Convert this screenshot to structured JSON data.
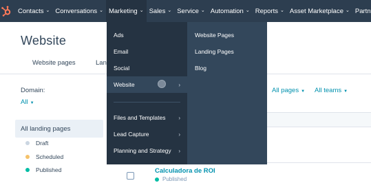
{
  "topnav": {
    "logo_icon": "hubspot-sprocket-icon",
    "items": [
      {
        "label": "Contacts"
      },
      {
        "label": "Conversations"
      },
      {
        "label": "Marketing"
      },
      {
        "label": "Sales"
      },
      {
        "label": "Service"
      },
      {
        "label": "Automation"
      },
      {
        "label": "Reports"
      },
      {
        "label": "Asset Marketplace"
      },
      {
        "label": "Partner"
      }
    ],
    "chevron": "⌄"
  },
  "page": {
    "title": "Website",
    "tabs": [
      {
        "label": "Website pages"
      },
      {
        "label": "Lan"
      }
    ]
  },
  "filters": {
    "domain_label": "Domain:",
    "domain_value": "All",
    "all_pages": "All pages",
    "all_teams": "All teams",
    "caret": "▼"
  },
  "sidebar": {
    "all_label": "All landing pages",
    "statuses": [
      {
        "label": "Draft",
        "color": "#cbd6e2"
      },
      {
        "label": "Scheduled",
        "color": "#f5c26b"
      },
      {
        "label": "Published",
        "color": "#00bda5"
      }
    ]
  },
  "table": {
    "row": {
      "title": "Calculadora de ROI",
      "status": "Published",
      "status_color": "#00bda5"
    }
  },
  "marketing_menu": {
    "left": [
      {
        "label": "Ads",
        "has_submenu": false
      },
      {
        "label": "Email",
        "has_submenu": false
      },
      {
        "label": "Social",
        "has_submenu": false
      },
      {
        "label": "Website",
        "has_submenu": true,
        "selected": true
      },
      {
        "label": "Files and Templates",
        "has_submenu": true
      },
      {
        "label": "Lead Capture",
        "has_submenu": true
      },
      {
        "label": "Planning and Strategy",
        "has_submenu": true
      }
    ],
    "right": [
      {
        "label": "Website Pages"
      },
      {
        "label": "Landing Pages"
      },
      {
        "label": "Blog"
      }
    ],
    "arrow": "›"
  },
  "colors": {
    "nav_bg": "#2d3e50",
    "menu_dark": "#253342",
    "menu_light": "#33475b",
    "link": "#0091ae",
    "accent": "#ff7a59"
  }
}
